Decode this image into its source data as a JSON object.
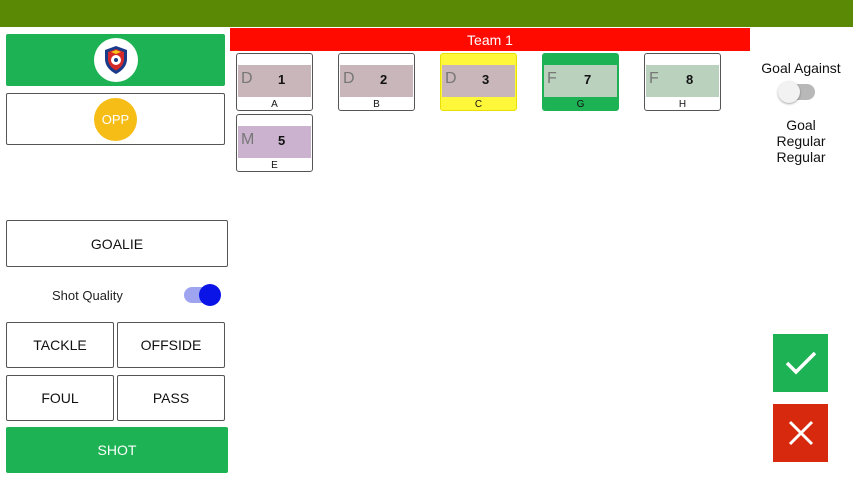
{
  "colors": {
    "top_bar": "#5a8a05",
    "accent_green": "#1db254",
    "team_header_red": "#ff0a00",
    "opp_circle": "#f6bd16",
    "toggle_on": "#0a14e6",
    "cancel_red": "#d6290e",
    "selected_yellow": "#fff83a"
  },
  "home_team": {
    "crest_icon": "team-crest-icon"
  },
  "opponent": {
    "label": "OPP"
  },
  "actions": {
    "goalie": "GOALIE",
    "shot_quality": {
      "label": "Shot Quality",
      "enabled": true
    },
    "tackle": "TACKLE",
    "offside": "OFFSIDE",
    "foul": "FOUL",
    "pass": "PASS",
    "shot": "SHOT"
  },
  "team_header": "Team 1",
  "players": [
    {
      "pos": "D",
      "number": "1",
      "letter": "A",
      "state": "normal"
    },
    {
      "pos": "D",
      "number": "2",
      "letter": "B",
      "state": "normal"
    },
    {
      "pos": "D",
      "number": "3",
      "letter": "C",
      "state": "selected-yellow"
    },
    {
      "pos": "F",
      "number": "7",
      "letter": "G",
      "state": "selected-green"
    },
    {
      "pos": "F",
      "number": "8",
      "letter": "H",
      "state": "normal"
    },
    {
      "pos": "M",
      "number": "5",
      "letter": "E",
      "state": "normal"
    }
  ],
  "goal_against": {
    "label": "Goal Against",
    "enabled": false
  },
  "status_lines": [
    "Goal",
    "Regular",
    "Regular"
  ],
  "confirm_icon": "check-icon",
  "cancel_icon": "close-icon"
}
